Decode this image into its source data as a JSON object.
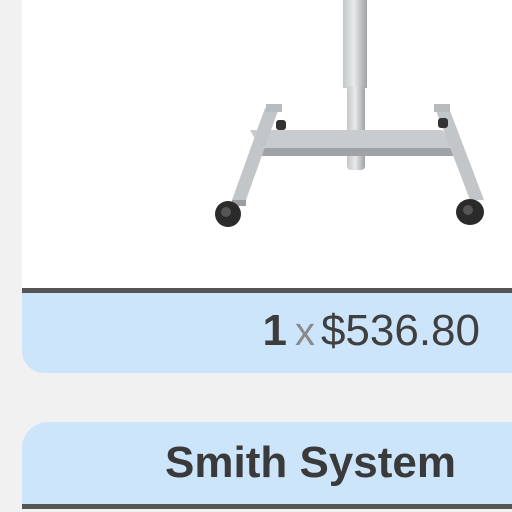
{
  "product_card": {
    "image_icon": "mobile-standing-desk-base-icon",
    "quantity": "1",
    "times_sign": "x",
    "price": "$536.80"
  },
  "next_card": {
    "title": "Smith System"
  },
  "colors": {
    "page_background": "#f1f1f1",
    "card_highlight": "#cde5fb",
    "divider": "#555555",
    "text": "#3f3f3f"
  }
}
